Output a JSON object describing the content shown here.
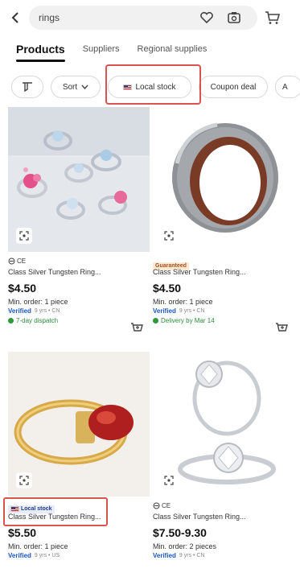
{
  "header": {
    "search_query": "rings",
    "icons": [
      "back-arrow-icon",
      "heart-icon",
      "camera-scan-icon",
      "cart-icon"
    ]
  },
  "tabs": [
    {
      "label": "Products",
      "active": true
    },
    {
      "label": "Suppliers",
      "active": false
    },
    {
      "label": "Regional supplies",
      "active": false
    }
  ],
  "filters": {
    "sort_label": "Sort",
    "local_stock_label": "Local stock",
    "coupon_label": "Coupon deal",
    "more_label": "A"
  },
  "products": [
    {
      "badge": "CE",
      "title": "Class Silver Tungsten Ring...",
      "price": "$4.50",
      "moq": "Min. order: 1 piece",
      "verified": "Verified",
      "years": "9 yrs • CN",
      "dispatch": "7-day dispatch"
    },
    {
      "badge": "Guaranteed",
      "title": "Class Silver Tungsten Ring...",
      "price": "$4.50",
      "moq": "Min. order: 1 piece",
      "verified": "Verified",
      "years": "9 yrs • CN",
      "dispatch": "Delivery by Mar 14"
    },
    {
      "badge": "Local stock",
      "title": "Class Silver Tungsten Ring...",
      "price": "$5.50",
      "moq": "Min. order: 1 piece",
      "verified": "Verified",
      "years": "9 yrs • US"
    },
    {
      "badge": "CE",
      "title": "Class Silver Tungsten Ring...",
      "price": "$7.50-9.30",
      "moq": "Min. order: 2 pieces",
      "verified": "Verified",
      "years": "9 yrs • CN"
    }
  ],
  "colors": {
    "highlight": "#d9534f",
    "verified": "#1a56c8",
    "dispatch": "#2a8a3a"
  }
}
